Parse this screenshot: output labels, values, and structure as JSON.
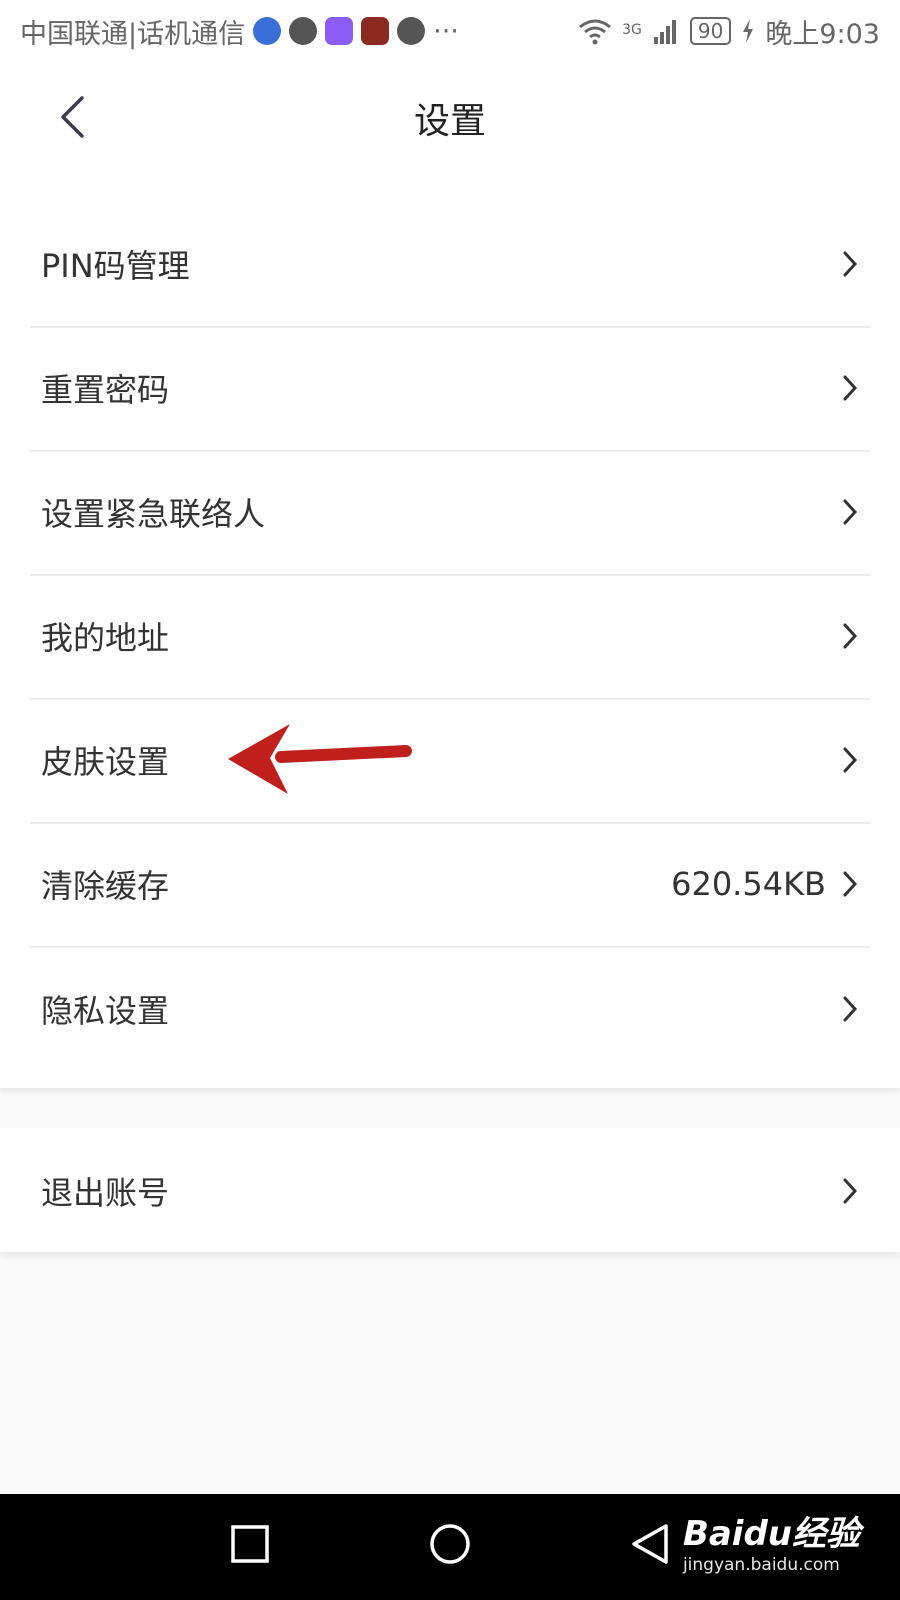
{
  "status_bar": {
    "carrier": "中国联通|话机通信",
    "more": "···",
    "network": "3G",
    "battery": "90",
    "time": "晚上9:03"
  },
  "header": {
    "title": "设置"
  },
  "settings": {
    "items": [
      {
        "label": "PIN码管理",
        "value": ""
      },
      {
        "label": "重置密码",
        "value": ""
      },
      {
        "label": "设置紧急联络人",
        "value": ""
      },
      {
        "label": "我的地址",
        "value": ""
      },
      {
        "label": "皮肤设置",
        "value": ""
      },
      {
        "label": "清除缓存",
        "value": "620.54KB"
      },
      {
        "label": "隐私设置",
        "value": ""
      }
    ]
  },
  "logout": {
    "label": "退出账号"
  },
  "watermark": {
    "logo": "Baidu经验",
    "url": "jingyan.baidu.com"
  },
  "colors": {
    "annotation_arrow": "#c0201c",
    "background": "#fafafa",
    "nav_bar": "#000000"
  },
  "icons": [
    "back-arrow-icon",
    "chevron-right-icon",
    "wifi-icon",
    "signal-icon",
    "charging-icon",
    "recent-apps-icon",
    "home-icon",
    "back-triangle-icon"
  ]
}
